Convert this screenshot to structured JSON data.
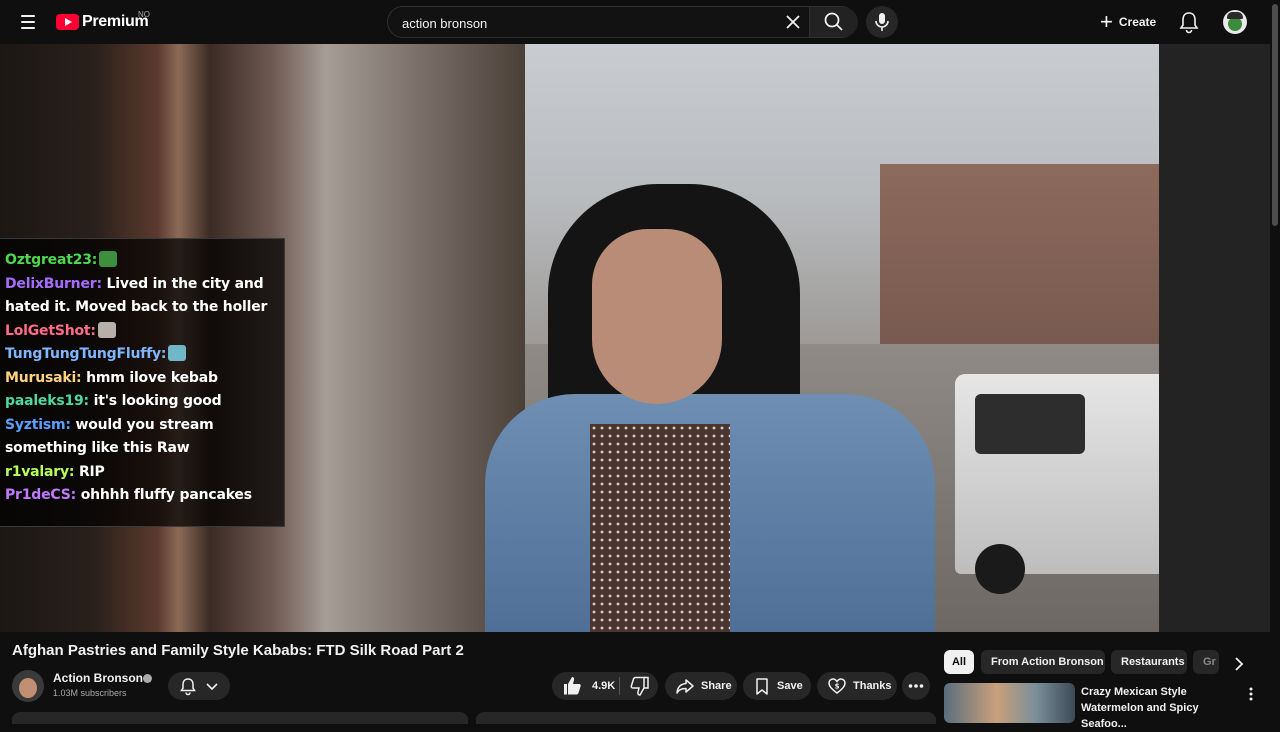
{
  "header": {
    "logo_text": "Premium",
    "region": "NO",
    "search": {
      "value": "action bronson",
      "placeholder": "Search"
    },
    "create_label": "Create"
  },
  "chat": [
    {
      "user": "Oztgreat23:",
      "color": "#4dd94d",
      "message": "",
      "emote": true
    },
    {
      "user": "DelixBurner:",
      "color": "#a66cff",
      "message": "Lived in the city and",
      "emote": false
    },
    {
      "user": "",
      "color": "#ffffff",
      "message": "hated it. Moved back to the holler",
      "emote": false
    },
    {
      "user": "LolGetShot:",
      "color": "#ff6b8a",
      "message": "",
      "emote": true
    },
    {
      "user": "TungTungTungFluffy:",
      "color": "#7fb7ff",
      "message": "",
      "emote": true
    },
    {
      "user": "Murusaki:",
      "color": "#ffd27f",
      "message": "hmm ilove kebab",
      "emote": false
    },
    {
      "user": "paaleks19:",
      "color": "#4dd9a0",
      "message": "it's looking good",
      "emote": false
    },
    {
      "user": "Syztism:",
      "color": "#5aa0ff",
      "message": "would you stream",
      "emote": false
    },
    {
      "user": "",
      "color": "#ffffff",
      "message": "something like this Raw",
      "emote": false
    },
    {
      "user": "r1valary:",
      "color": "#b6ff5a",
      "message": "RIP",
      "emote": false
    },
    {
      "user": "Pr1deCS:",
      "color": "#c07bff",
      "message": "ohhhh fluffy pancakes",
      "emote": false
    }
  ],
  "video": {
    "title": "Afghan Pastries and Family Style Kababs: FTD Silk Road Part 2",
    "channel": "Action Bronson",
    "subscribers": "1.03M subscribers",
    "likes": "4.9K",
    "share_label": "Share",
    "save_label": "Save",
    "thanks_label": "Thanks"
  },
  "chips": [
    "All",
    "From Action Bronson",
    "Restaurants",
    "Gr"
  ],
  "related": [
    {
      "title": "Crazy Mexican Style Watermelon and Spicy Seafoo..."
    }
  ]
}
